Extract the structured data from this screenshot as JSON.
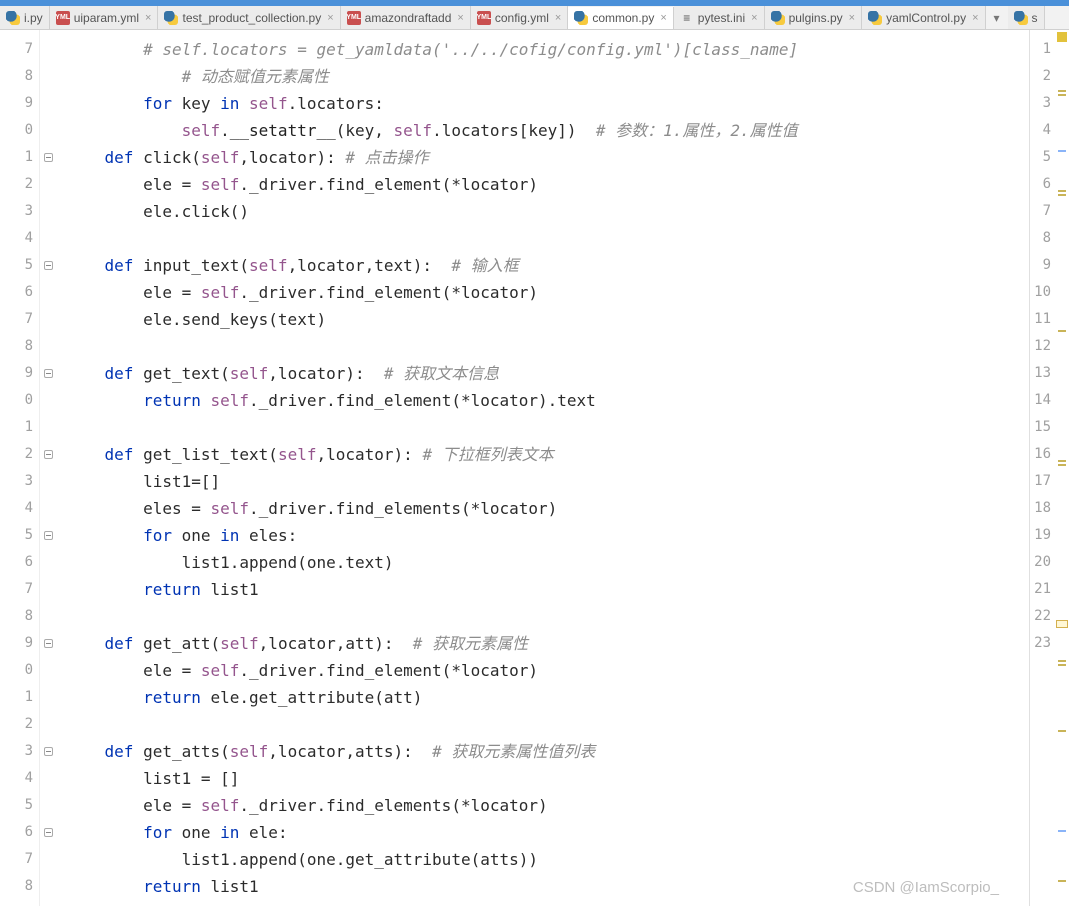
{
  "tabs": [
    {
      "label": "i.py",
      "icon": "py",
      "active": false,
      "close": false
    },
    {
      "label": "uiparam.yml",
      "icon": "yml",
      "active": false,
      "close": true
    },
    {
      "label": "test_product_collection.py",
      "icon": "py",
      "active": false,
      "close": true
    },
    {
      "label": "amazondraftadd",
      "icon": "yml",
      "active": false,
      "close": true
    },
    {
      "label": "config.yml",
      "icon": "yml",
      "active": false,
      "close": true
    },
    {
      "label": "common.py",
      "icon": "py",
      "active": true,
      "close": true
    },
    {
      "label": "pytest.ini",
      "icon": "ini",
      "active": false,
      "close": true
    },
    {
      "label": "pulgins.py",
      "icon": "py",
      "active": false,
      "close": true
    },
    {
      "label": "yamlControl.py",
      "icon": "py",
      "active": false,
      "close": true
    }
  ],
  "gutter_start": 7,
  "gutter_end": 8,
  "right_numbers": [
    1,
    2,
    3,
    4,
    5,
    6,
    7,
    8,
    9,
    10,
    11,
    12,
    13,
    14,
    15,
    16,
    17,
    18,
    19,
    20,
    21,
    22,
    23
  ],
  "code": {
    "l1_a": "        # self.locators = get_yamldata('../../cofig/config.yml')[class_name]",
    "l2_a": "            # 动态赋值元素属性",
    "l3_for": "for",
    "l3_in": "in",
    "l3_key": " key ",
    "l3_self": "self",
    "l3_rest": ".locators:",
    "l4_self1": "self",
    "l4_mid": ".",
    "l4_fn": "__setattr__",
    "l4_paren": "(key, ",
    "l4_self2": "self",
    "l4_rest": ".locators[key])  ",
    "l4_cmt": "# 参数：1.属性，2.属性值",
    "l5_def": "def",
    "l5_name": " click(",
    "l5_self": "self",
    "l5_rest": ",locator): ",
    "l5_cmt": "# 点击操作",
    "l6_a": "        ele = ",
    "l6_self": "self",
    "l6_rest": "._driver.find_element(*locator)",
    "l7_a": "        ele.click()",
    "l9_def": "def",
    "l9_name": " input_text(",
    "l9_self": "self",
    "l9_rest": ",locator,text):  ",
    "l9_cmt": "# 输入框",
    "l10_a": "        ele = ",
    "l10_self": "self",
    "l10_rest": "._driver.find_element(*locator)",
    "l11_a": "        ele.send_keys(text)",
    "l13_def": "def",
    "l13_name": " get_text(",
    "l13_self": "self",
    "l13_rest": ",locator):  ",
    "l13_cmt": "# 获取文本信息",
    "l14_ret": "return ",
    "l14_self": "self",
    "l14_rest": "._driver.find_element(*locator).text",
    "l16_def": "def",
    "l16_name": " get_list_text(",
    "l16_self": "self",
    "l16_rest": ",locator): ",
    "l16_cmt": "# 下拉框列表文本",
    "l17_a": "        list1=[]",
    "l18_a": "        eles = ",
    "l18_self": "self",
    "l18_rest": "._driver.find_elements(*locator)",
    "l19_for": "for",
    "l19_mid": " one ",
    "l19_in": "in",
    "l19_rest": " eles:",
    "l20_a": "            list1.append(one.text)",
    "l21_ret": "return",
    "l21_rest": " list1",
    "l23_def": "def",
    "l23_name": " get_att(",
    "l23_self": "self",
    "l23_rest": ",locator,att):  ",
    "l23_cmt": "# 获取元素属性",
    "l24_a": "        ele = ",
    "l24_self": "self",
    "l24_rest": "._driver.find_element(*locator)",
    "l25_ret": "return",
    "l25_rest": " ele.get_attribute(att)",
    "l27_def": "def",
    "l27_name": " get_atts(",
    "l27_self": "self",
    "l27_rest": ",locator,atts):  ",
    "l27_cmt": "# 获取元素属性值列表",
    "l28_a": "        list1 = []",
    "l29_a": "        ele = ",
    "l29_self": "self",
    "l29_rest": "._driver.find_elements(*locator)",
    "l30_for": "for",
    "l30_mid": " one ",
    "l30_in": "in",
    "l30_rest": " ele:",
    "l31_a": "            list1.append(one.get_attribute(atts))",
    "l32_ret": "return",
    "l32_rest": " list1"
  },
  "watermark": "CSDN @IamScorpio_"
}
